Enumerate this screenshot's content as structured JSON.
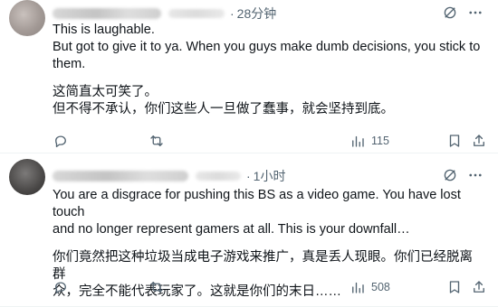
{
  "posts": [
    {
      "time": "28分钟",
      "lines_en": [
        "This is laughable.",
        "But got to give it to ya. When you guys make dumb decisions, you stick to",
        "them."
      ],
      "lines_zh": [
        "这简直太可笑了。",
        "但不得不承认，你们这些人一旦做了蠢事，就会坚持到底。"
      ],
      "views": "115"
    },
    {
      "time": "1小时",
      "lines_en": [
        "You are a disgrace for pushing this BS as a video game. You have lost touch",
        "and no longer represent gamers at all. This is your downfall…"
      ],
      "lines_zh": [
        "你们竟然把这种垃圾当成电子游戏来推广，真是丢人现眼。你们已经脱离群",
        "众，完全不能代表玩家了。这就是你们的末日……"
      ],
      "views": "508"
    }
  ],
  "icons": {
    "reply": "reply-icon",
    "repost": "repost-icon",
    "views": "views-icon",
    "bookmark": "bookmark-icon",
    "share": "share-icon",
    "grok": "grok-icon",
    "more": "more-icon"
  },
  "colors": {
    "text": "#0f1419",
    "secondary": "#536471",
    "divider": "#eff3f4"
  }
}
